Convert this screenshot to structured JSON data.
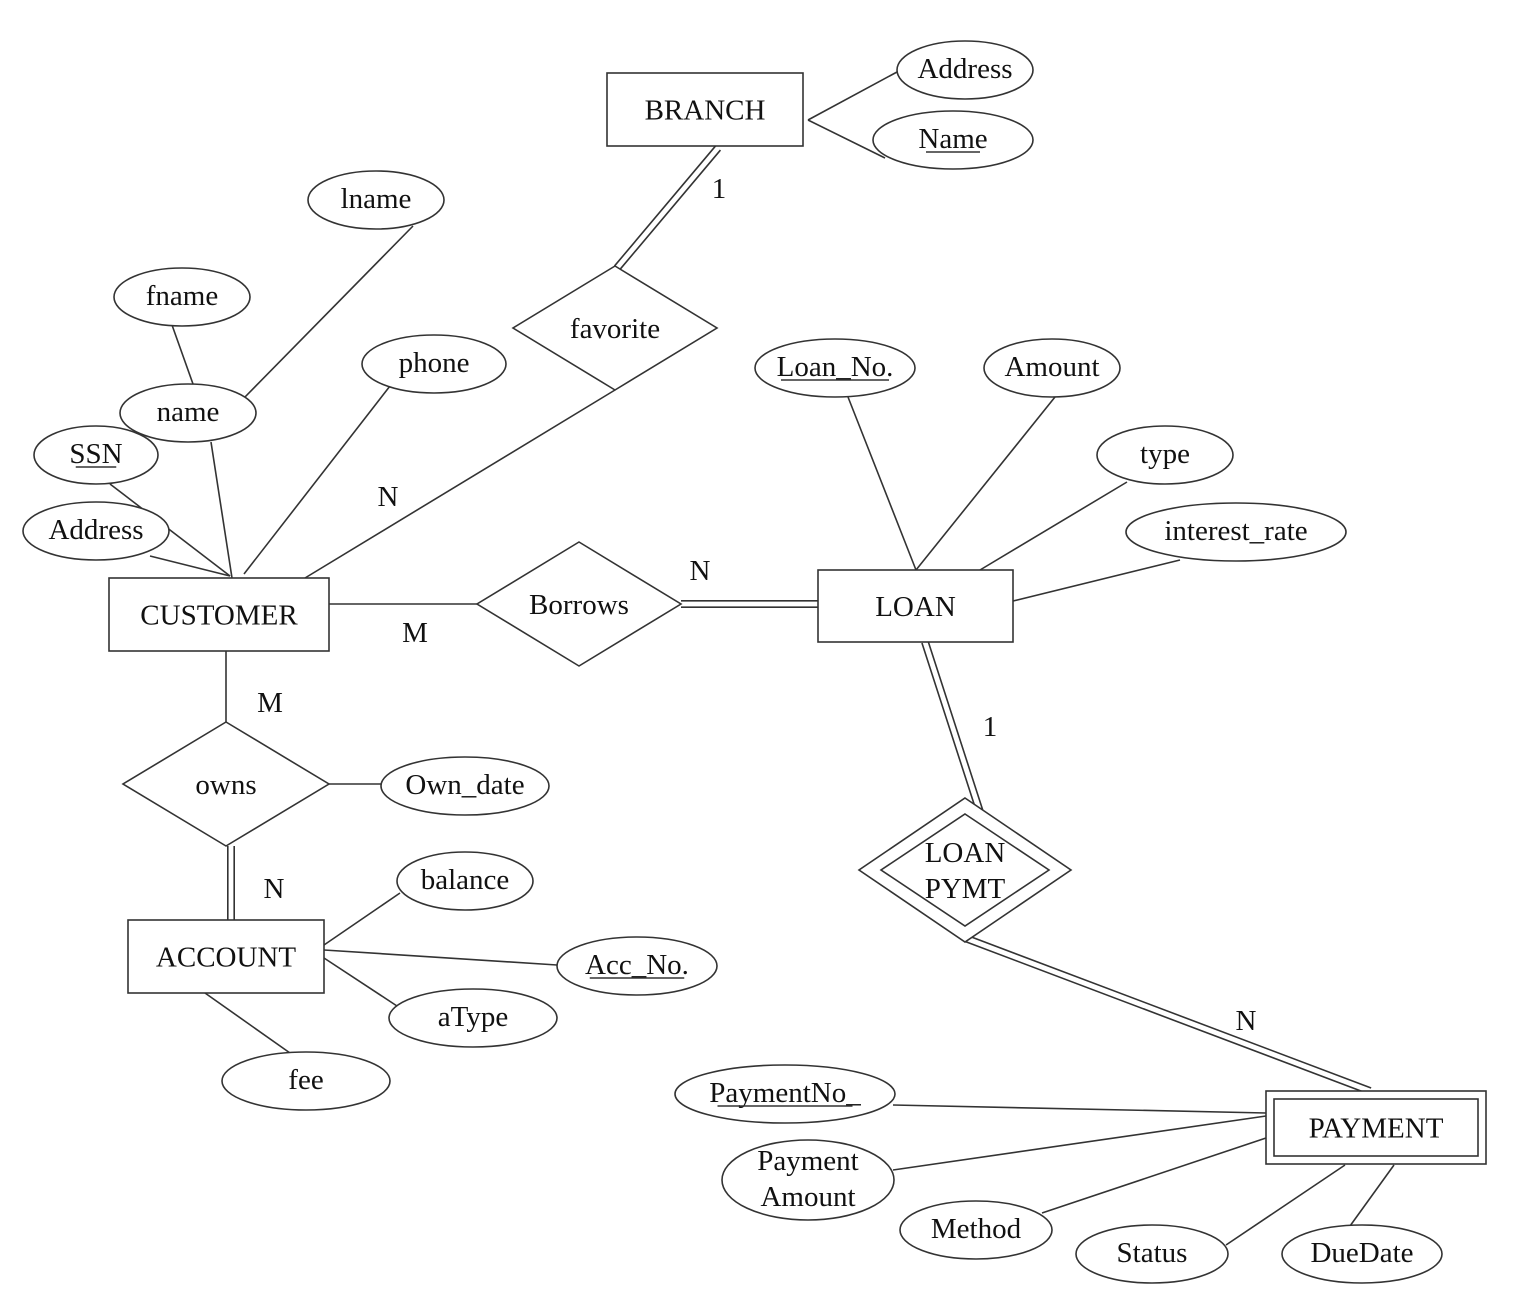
{
  "entities": [
    {
      "id": "branch",
      "label": "BRANCH",
      "weak": false
    },
    {
      "id": "customer",
      "label": "CUSTOMER",
      "weak": false
    },
    {
      "id": "loan",
      "label": "LOAN",
      "weak": false
    },
    {
      "id": "account",
      "label": "ACCOUNT",
      "weak": false
    },
    {
      "id": "payment",
      "label": "PAYMENT",
      "weak": true
    }
  ],
  "relationships": [
    {
      "id": "favorite",
      "label": [
        "favorite"
      ],
      "identifying": false
    },
    {
      "id": "borrows",
      "label": [
        "Borrows"
      ],
      "identifying": false
    },
    {
      "id": "owns",
      "label": [
        "owns"
      ],
      "identifying": false
    },
    {
      "id": "loanpymt",
      "label": [
        "LOAN",
        "PYMT"
      ],
      "identifying": true
    }
  ],
  "attributes": [
    {
      "id": "branch-address",
      "label": [
        "Address"
      ],
      "key": false
    },
    {
      "id": "branch-name",
      "label": [
        "Name"
      ],
      "key": true
    },
    {
      "id": "lname",
      "label": [
        "lname"
      ],
      "key": false
    },
    {
      "id": "fname",
      "label": [
        "fname"
      ],
      "key": false
    },
    {
      "id": "phone",
      "label": [
        "phone"
      ],
      "key": false
    },
    {
      "id": "name",
      "label": [
        "name"
      ],
      "key": false
    },
    {
      "id": "ssn",
      "label": [
        "SSN"
      ],
      "key": true
    },
    {
      "id": "customer-address",
      "label": [
        "Address"
      ],
      "key": false
    },
    {
      "id": "loan-no",
      "label": [
        "Loan_No."
      ],
      "key": true
    },
    {
      "id": "amount",
      "label": [
        "Amount"
      ],
      "key": false
    },
    {
      "id": "type",
      "label": [
        "type"
      ],
      "key": false
    },
    {
      "id": "interest-rate",
      "label": [
        "interest_rate"
      ],
      "key": false
    },
    {
      "id": "own-date",
      "label": [
        "Own_date"
      ],
      "key": false
    },
    {
      "id": "balance",
      "label": [
        "balance"
      ],
      "key": false
    },
    {
      "id": "acc-no",
      "label": [
        "Acc_No."
      ],
      "key": true
    },
    {
      "id": "atype",
      "label": [
        "aType"
      ],
      "key": false
    },
    {
      "id": "fee",
      "label": [
        "fee"
      ],
      "key": false
    },
    {
      "id": "payment-no",
      "label": [
        "PaymentNo_"
      ],
      "key": true
    },
    {
      "id": "payment-amount",
      "label": [
        "Payment",
        "Amount"
      ],
      "key": false
    },
    {
      "id": "method",
      "label": [
        "Method"
      ],
      "key": false
    },
    {
      "id": "status",
      "label": [
        "Status"
      ],
      "key": false
    },
    {
      "id": "due-date",
      "label": [
        "DueDate"
      ],
      "key": false
    }
  ],
  "cardinalities": [
    {
      "id": "branch-favorite",
      "label": "1"
    },
    {
      "id": "customer-favorite",
      "label": "N"
    },
    {
      "id": "customer-borrows",
      "label": "M"
    },
    {
      "id": "loan-borrows",
      "label": "N"
    },
    {
      "id": "customer-owns",
      "label": "M"
    },
    {
      "id": "account-owns",
      "label": "N"
    },
    {
      "id": "loan-loanpymt",
      "label": "1"
    },
    {
      "id": "payment-loanpymt",
      "label": "N"
    }
  ]
}
